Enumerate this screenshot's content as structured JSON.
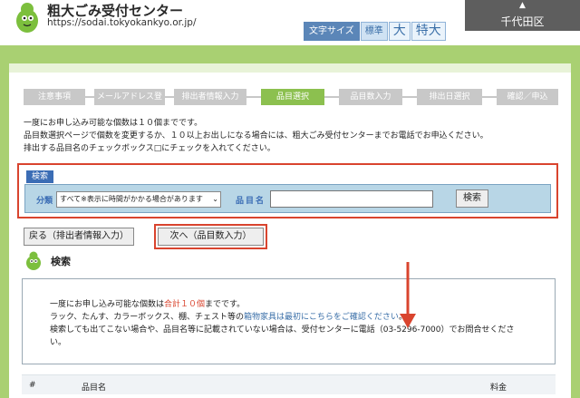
{
  "header": {
    "site_title": "粗大ごみ受付センター",
    "site_url": "https://sodai.tokyokankyo.or.jp/",
    "font_size_label": "文字サイズ",
    "font_size_options": [
      "標準",
      "大",
      "特大"
    ],
    "ward_arrow": "▲",
    "ward_name": "千代田区"
  },
  "steps": [
    "注意事項",
    "メールアドレス登録",
    "排出者情報入力",
    "品目選択",
    "品目数入力",
    "排出日選択",
    "確認／申込"
  ],
  "active_step": "品目選択",
  "intro_lines": [
    "一度にお申し込み可能な個数は１０個までです。",
    "品目数選択ページで個数を変更するか、１０以上お出しになる場合には、粗大ごみ受付センターまでお電話でお申込ください。",
    "排出する品目名のチェックボックス□にチェックを入れてください。"
  ],
  "search": {
    "tab_label": "検索",
    "category_label": "分類",
    "category_value": "すべて※表示に時間がかかる場合があります",
    "item_name_label": "品目名",
    "item_name_value": "",
    "button_label": "検索"
  },
  "nav": {
    "back_label": "戻る（排出者情報入力）",
    "next_label": "次へ（品目数入力）"
  },
  "section_heading": "検索",
  "info": {
    "line1_pre": "一度にお申し込み可能な個数は",
    "line1_red": "合計１０個",
    "line1_post": "までです。",
    "line2_pre": "ラック、たんす、カラーボックス、棚、チェスト等の",
    "line2_link": "箱物家具は最初にこちらをご確認ください",
    "line2_post": "。",
    "line3": "検索しても出てこない場合や、品目名等に記載されていない場合は、受付センターに電話（03-5296-7000）でお問合せくださ",
    "line4": "い。"
  },
  "table": {
    "headers": [
      "#",
      "品目名",
      "料金"
    ]
  },
  "colors": {
    "accent_green": "#a9d072",
    "highlight_red": "#d9442e",
    "search_blue": "#3b6db5"
  }
}
